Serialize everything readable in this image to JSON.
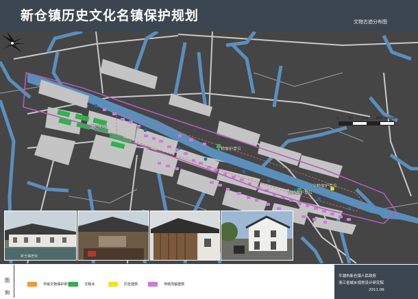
{
  "header": {
    "title": "新仓镇历史文化名镇保护规划",
    "subtitle": "文物古迹分布图"
  },
  "map": {
    "labels": [
      "江边地块",
      "文物保护单位",
      "文物保护单位",
      "文物保护单位"
    ],
    "scale": {
      "ticks": [
        "0",
        "50",
        "100",
        "200",
        "400m"
      ]
    },
    "colors": {
      "water": "#5a8fbc",
      "land": "#454545",
      "blocks": "#c4c4c4",
      "historic": "#cf79e0",
      "green": "#2db34a",
      "boundary": "#b55bbf",
      "road": "#e4e4e4"
    }
  },
  "photos": {
    "captions": [
      "新仓镇老街"
    ]
  },
  "legend": {
    "heading": [
      "图",
      "例"
    ],
    "items": [
      {
        "label": "市级文物保护单位",
        "color": "#f39a2b"
      },
      {
        "label": "文物点",
        "color": "#2db34a"
      },
      {
        "label": "历史建筑",
        "color": "#f4e515"
      },
      {
        "label": "传统风貌建筑",
        "color": "#cf79e0"
      }
    ]
  },
  "credits": {
    "lines": [
      "平湖市新仓镇人民政府",
      "浙江省城乡规划设计研究院",
      "2011.06"
    ]
  }
}
